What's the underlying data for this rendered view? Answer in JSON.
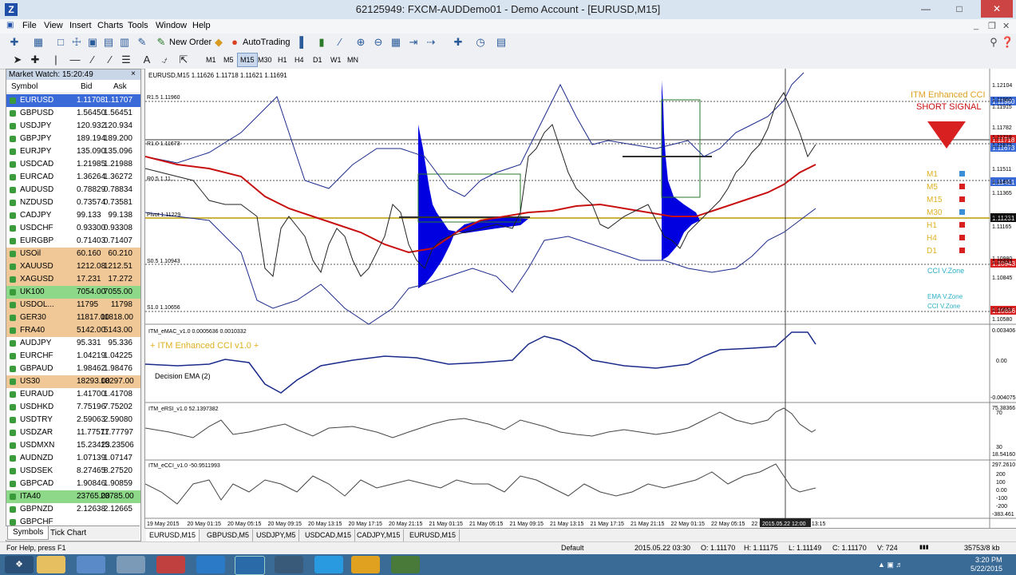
{
  "window": {
    "title": "62125949: FXCM-AUDDemo01 - Demo Account - [EURUSD,M15]",
    "app_icon": "Z"
  },
  "menu": [
    "File",
    "View",
    "Insert",
    "Charts",
    "Tools",
    "Window",
    "Help"
  ],
  "toolbar": {
    "new_order": "New Order",
    "autotrading": "AutoTrading",
    "timeframes": [
      "M1",
      "M5",
      "M15",
      "M30",
      "H1",
      "H4",
      "D1",
      "W1",
      "MN"
    ],
    "active_timeframe": "M15"
  },
  "market_watch": {
    "title": "Market Watch: 15:20:49",
    "headers": {
      "symbol": "Symbol",
      "bid": "Bid",
      "ask": "Ask"
    },
    "rows": [
      {
        "symbol": "EURUSD",
        "bid": "1.11708",
        "ask": "1.11707",
        "style": "selected"
      },
      {
        "symbol": "GBPUSD",
        "bid": "1.56450",
        "ask": "1.56451",
        "style": ""
      },
      {
        "symbol": "USDJPY",
        "bid": "120.932",
        "ask": "120.934",
        "style": ""
      },
      {
        "symbol": "GBPJPY",
        "bid": "189.194",
        "ask": "189.200",
        "style": ""
      },
      {
        "symbol": "EURJPY",
        "bid": "135.090",
        "ask": "135.096",
        "style": ""
      },
      {
        "symbol": "USDCAD",
        "bid": "1.21985",
        "ask": "1.21988",
        "style": ""
      },
      {
        "symbol": "EURCAD",
        "bid": "1.36264",
        "ask": "1.36272",
        "style": ""
      },
      {
        "symbol": "AUDUSD",
        "bid": "0.78829",
        "ask": "0.78834",
        "style": ""
      },
      {
        "symbol": "NZDUSD",
        "bid": "0.73574",
        "ask": "0.73581",
        "style": ""
      },
      {
        "symbol": "CADJPY",
        "bid": "99.133",
        "ask": "99.138",
        "style": ""
      },
      {
        "symbol": "USDCHF",
        "bid": "0.93300",
        "ask": "0.93308",
        "style": ""
      },
      {
        "symbol": "EURGBP",
        "bid": "0.71403",
        "ask": "0.71407",
        "style": ""
      },
      {
        "symbol": "USOil",
        "bid": "60.160",
        "ask": "60.210",
        "style": "orange"
      },
      {
        "symbol": "XAUUSD",
        "bid": "1212.08",
        "ask": "1212.51",
        "style": "orange"
      },
      {
        "symbol": "XAGUSD",
        "bid": "17.231",
        "ask": "17.272",
        "style": "orange"
      },
      {
        "symbol": "UK100",
        "bid": "7054.00",
        "ask": "7055.00",
        "style": "green"
      },
      {
        "symbol": "USDOL...",
        "bid": "11795",
        "ask": "11798",
        "style": "orange"
      },
      {
        "symbol": "GER30",
        "bid": "11817.00",
        "ask": "11818.00",
        "style": "orange"
      },
      {
        "symbol": "FRA40",
        "bid": "5142.00",
        "ask": "5143.00",
        "style": "orange"
      },
      {
        "symbol": "AUDJPY",
        "bid": "95.331",
        "ask": "95.336",
        "style": ""
      },
      {
        "symbol": "EURCHF",
        "bid": "1.04219",
        "ask": "1.04225",
        "style": ""
      },
      {
        "symbol": "GBPAUD",
        "bid": "1.98462",
        "ask": "1.98476",
        "style": ""
      },
      {
        "symbol": "US30",
        "bid": "18293.00",
        "ask": "18297.00",
        "style": "orange"
      },
      {
        "symbol": "EURAUD",
        "bid": "1.41700",
        "ask": "1.41708",
        "style": ""
      },
      {
        "symbol": "USDHKD",
        "bid": "7.75196",
        "ask": "7.75202",
        "style": ""
      },
      {
        "symbol": "USDTRY",
        "bid": "2.59063",
        "ask": "2.59080",
        "style": ""
      },
      {
        "symbol": "USDZAR",
        "bid": "11.77577",
        "ask": "11.77797",
        "style": ""
      },
      {
        "symbol": "USDMXN",
        "bid": "15.23423",
        "ask": "15.23506",
        "style": ""
      },
      {
        "symbol": "AUDNZD",
        "bid": "1.07139",
        "ask": "1.07147",
        "style": ""
      },
      {
        "symbol": "USDSEK",
        "bid": "8.27465",
        "ask": "8.27520",
        "style": ""
      },
      {
        "symbol": "GBPCAD",
        "bid": "1.90846",
        "ask": "1.90859",
        "style": ""
      },
      {
        "symbol": "ITA40",
        "bid": "23765.00",
        "ask": "23785.00",
        "style": "green"
      },
      {
        "symbol": "GBPNZD",
        "bid": "2.12638",
        "ask": "2.12665",
        "style": ""
      },
      {
        "symbol": "GBPCHF",
        "bid": "",
        "ask": "",
        "style": ""
      }
    ],
    "tabs": [
      "Symbols",
      "Tick Chart"
    ]
  },
  "chart": {
    "header": "EURUSD,M15  1.11626 1.11718 1.11621 1.11691",
    "levels": {
      "r15": "R1.5 1.11960",
      "r1": "R1.0 1.11673",
      "r05": "R0.5 1.11...",
      "pivot": "Pivot 1.11229",
      "s05": "S0.5 1.10943",
      "s1": "S1.0 1.10656"
    },
    "price_axis": [
      "1.12104",
      "1.11960",
      "1.11915",
      "1.11782",
      "1.11718",
      "1.11673",
      "1.11511",
      "1.11451",
      "1.11365",
      "1.11231",
      "1.11165",
      "1.10980",
      "1.10943",
      "1.10845",
      "1.10656",
      "1.10580"
    ],
    "price_badges": {
      "r15": "1.11960",
      "bid": "1.11718",
      "r1": "1.11673",
      "r05": "1.11451",
      "pivot": "1.11231",
      "s05": "1.10943",
      "s1": "1.10656"
    },
    "signal_title": "ITM Enhanced CCI",
    "signal_text": "SHORT SIGNAL",
    "timeframe_dashboard": [
      {
        "tf": "M1",
        "color": "#3a8fd8"
      },
      {
        "tf": "M5",
        "color": "#d82020"
      },
      {
        "tf": "M15",
        "color": "#d82020"
      },
      {
        "tf": "M30",
        "color": "#3a8fd8"
      },
      {
        "tf": "H1",
        "color": "#d82020"
      },
      {
        "tf": "H4",
        "color": "#d82020"
      },
      {
        "tf": "D1",
        "color": "#d82020"
      }
    ],
    "cci_vzone": "CCI V.Zone",
    "ema_vzone": "EMA V.Zone",
    "emac_header": "ITM_eMAC_v1.0 0.0005636 0.0010332",
    "emac_label": "+ ITM Enhanced CCI v1.0 +",
    "emac_decision": "Decision EMA (2)",
    "emac_axis": [
      "0.003406",
      "0.00",
      "-0.004075"
    ],
    "ersi_header": "ITM_eRSI_v1.0 52.1397382",
    "ersi_axis": [
      "75.38366",
      "70",
      "30",
      "18.54160"
    ],
    "ecci_header": "ITM_eCCI_v1.0 -50.9511993",
    "ecci_axis": [
      "297.2610",
      "200",
      "100",
      "0.00",
      "-100",
      "-200",
      "-383.461"
    ],
    "time_axis": [
      "19 May 2015",
      "20 May 01:15",
      "20 May 05:15",
      "20 May 09:15",
      "20 May 13:15",
      "20 May 17:15",
      "20 May 21:15",
      "21 May 01:15",
      "21 May 05:15",
      "21 May 09:15",
      "21 May 13:15",
      "21 May 17:15",
      "21 May 21:15",
      "22 May 01:15",
      "22 May 05:15",
      "22 May 09:15",
      "22 May 13:15"
    ],
    "cursor_time": "2015.05.22 12:00"
  },
  "chart_tabs": [
    "EURUSD,M15",
    "GBPUSD,M5",
    "USDJPY,M5",
    "USDCAD,M15",
    "CADJPY,M15",
    "EURUSD,M15"
  ],
  "status": {
    "help": "For Help, press F1",
    "profile": "Default",
    "datetime": "2015.05.22 03:30",
    "open": "O: 1.11170",
    "high": "H: 1.11175",
    "low": "L: 1.11149",
    "close": "C: 1.11170",
    "volume": "V: 724",
    "traffic": "35753/8 kb"
  },
  "taskbar": {
    "time": "3:20 PM",
    "date": "5/22/2015"
  }
}
